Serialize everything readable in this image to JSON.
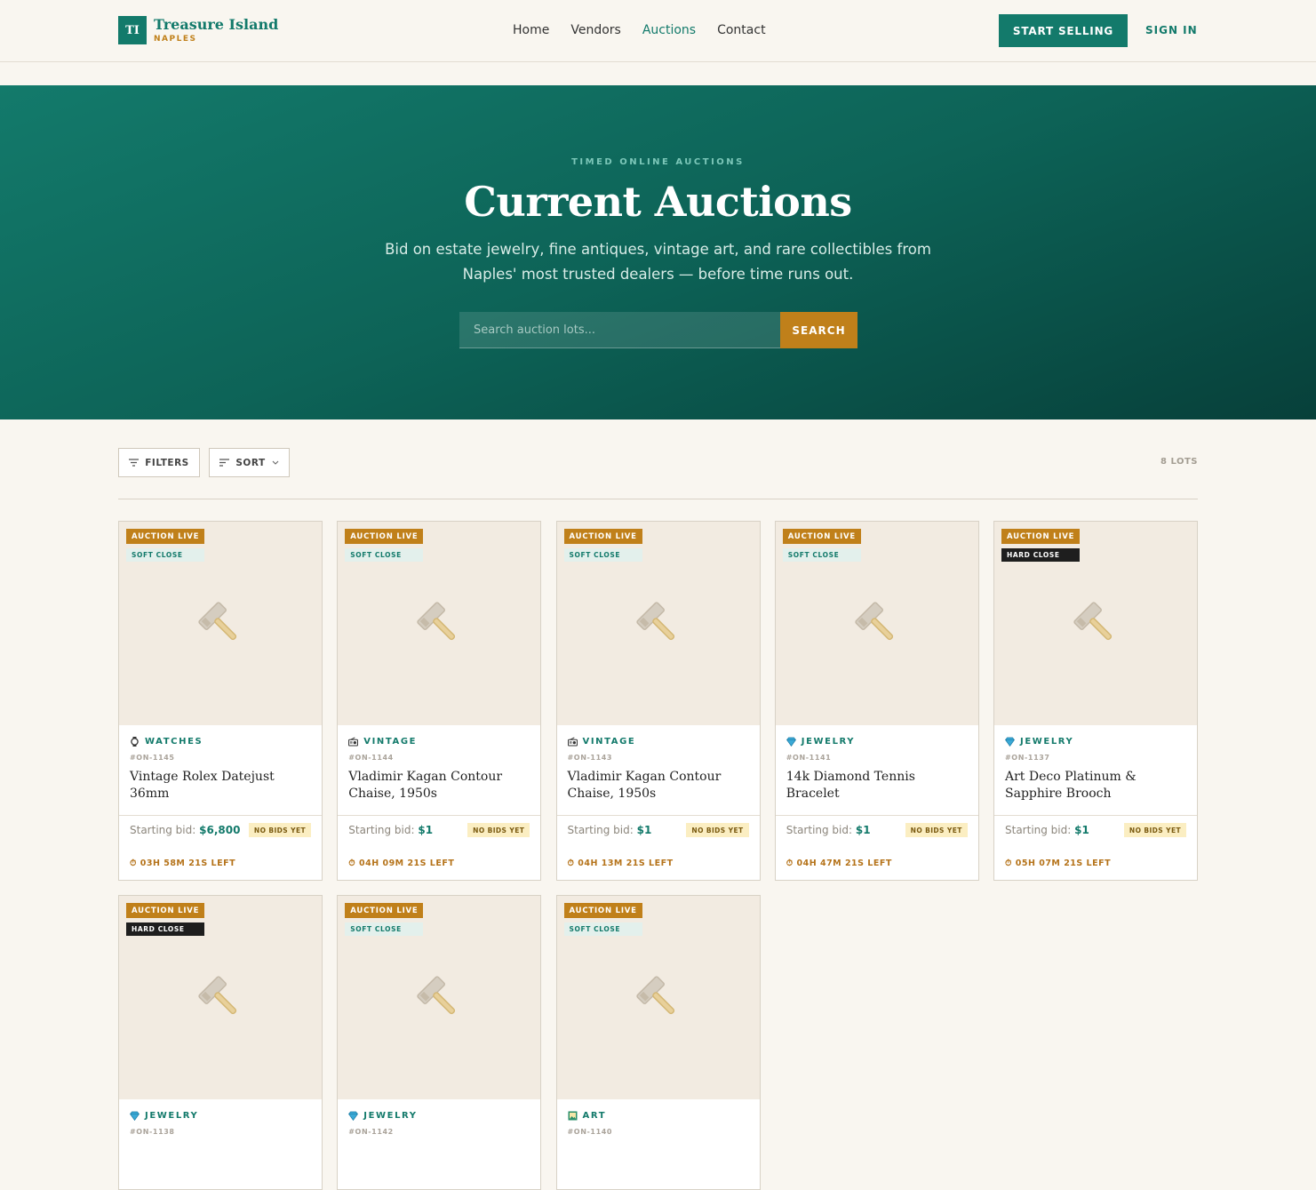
{
  "brand": {
    "mark": "TI",
    "name": "Treasure Island",
    "sub": "NAPLES"
  },
  "nav": [
    {
      "label": "Home",
      "active": false
    },
    {
      "label": "Vendors",
      "active": false
    },
    {
      "label": "Auctions",
      "active": true
    },
    {
      "label": "Contact",
      "active": false
    }
  ],
  "header": {
    "start_selling": "START SELLING",
    "sign_in": "SIGN IN"
  },
  "hero": {
    "eyebrow": "TIMED ONLINE AUCTIONS",
    "title": "Current Auctions",
    "description": "Bid on estate jewelry, fine antiques, vintage art, and rare collectibles from Naples' most trusted dealers — before time runs out.",
    "search_placeholder": "Search auction lots...",
    "search_button": "SEARCH"
  },
  "toolbar": {
    "filters": "FILTERS",
    "sort": "SORT",
    "count": "8 LOTS"
  },
  "colors": {
    "primary": "#137a6b",
    "accent": "#c0801a",
    "background": "#f9f6f0"
  },
  "lots": [
    {
      "status": "AUCTION LIVE",
      "close": "SOFT CLOSE",
      "close_type": "soft",
      "category": "WATCHES",
      "category_icon": "watch-icon",
      "id": "#ON-1145",
      "title": "Vintage Rolex Datejust 36mm",
      "bid_label": "Starting bid:",
      "bid": "$6,800",
      "bids_badge": "NO BIDS YET",
      "time_left": "03H 58M 21S LEFT"
    },
    {
      "status": "AUCTION LIVE",
      "close": "SOFT CLOSE",
      "close_type": "soft",
      "category": "VINTAGE",
      "category_icon": "radio-icon",
      "id": "#ON-1144",
      "title": "Vladimir Kagan Contour Chaise, 1950s",
      "bid_label": "Starting bid:",
      "bid": "$1",
      "bids_badge": "NO BIDS YET",
      "time_left": "04H 09M 21S LEFT"
    },
    {
      "status": "AUCTION LIVE",
      "close": "SOFT CLOSE",
      "close_type": "soft",
      "category": "VINTAGE",
      "category_icon": "radio-icon",
      "id": "#ON-1143",
      "title": "Vladimir Kagan Contour Chaise, 1950s",
      "bid_label": "Starting bid:",
      "bid": "$1",
      "bids_badge": "NO BIDS YET",
      "time_left": "04H 13M 21S LEFT"
    },
    {
      "status": "AUCTION LIVE",
      "close": "SOFT CLOSE",
      "close_type": "soft",
      "category": "JEWELRY",
      "category_icon": "diamond-icon",
      "id": "#ON-1141",
      "title": "14k Diamond Tennis Bracelet",
      "bid_label": "Starting bid:",
      "bid": "$1",
      "bids_badge": "NO BIDS YET",
      "time_left": "04H 47M 21S LEFT"
    },
    {
      "status": "AUCTION LIVE",
      "close": "HARD CLOSE",
      "close_type": "hard",
      "category": "JEWELRY",
      "category_icon": "diamond-icon",
      "id": "#ON-1137",
      "title": "Art Deco Platinum & Sapphire Brooch",
      "bid_label": "Starting bid:",
      "bid": "$1",
      "bids_badge": "NO BIDS YET",
      "time_left": "05H 07M 21S LEFT"
    },
    {
      "status": "AUCTION LIVE",
      "close": "HARD CLOSE",
      "close_type": "hard",
      "category": "JEWELRY",
      "category_icon": "diamond-icon",
      "id": "#ON-1138"
    },
    {
      "status": "AUCTION LIVE",
      "close": "SOFT CLOSE",
      "close_type": "soft",
      "category": "JEWELRY",
      "category_icon": "diamond-icon",
      "id": "#ON-1142"
    },
    {
      "status": "AUCTION LIVE",
      "close": "SOFT CLOSE",
      "close_type": "soft",
      "category": "ART",
      "category_icon": "art-icon",
      "id": "#ON-1140"
    }
  ]
}
